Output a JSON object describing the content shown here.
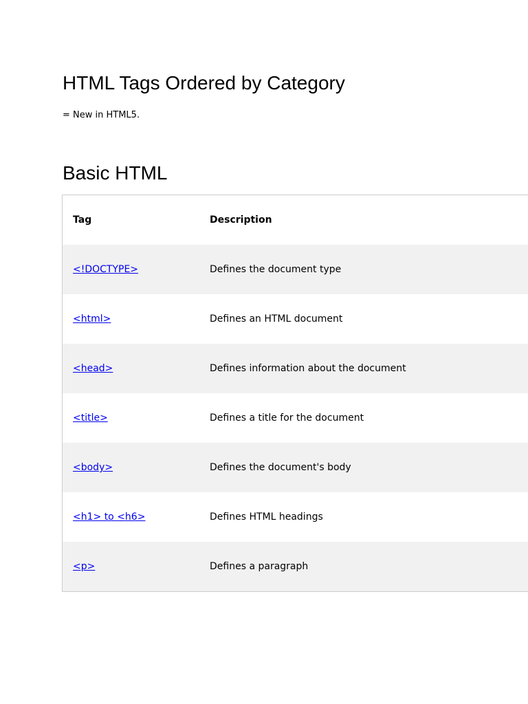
{
  "title": "HTML Tags Ordered by Category",
  "note": "= New in HTML5.",
  "section": "Basic HTML",
  "table": {
    "headers": [
      "Tag",
      "Description"
    ],
    "rows": [
      {
        "tag": "<!DOCTYPE>",
        "desc": "Defines the document type"
      },
      {
        "tag": "<html>",
        "desc": "Defines an HTML document"
      },
      {
        "tag": "<head>",
        "desc": "Defines information about the document"
      },
      {
        "tag": "<title>",
        "desc": "Defines a title for the document"
      },
      {
        "tag": "<body>",
        "desc": "Defines the document's body"
      },
      {
        "tag": "<h1> to <h6>",
        "desc": "Defines HTML headings"
      },
      {
        "tag": "<p>",
        "desc": "Defines a paragraph"
      }
    ]
  }
}
